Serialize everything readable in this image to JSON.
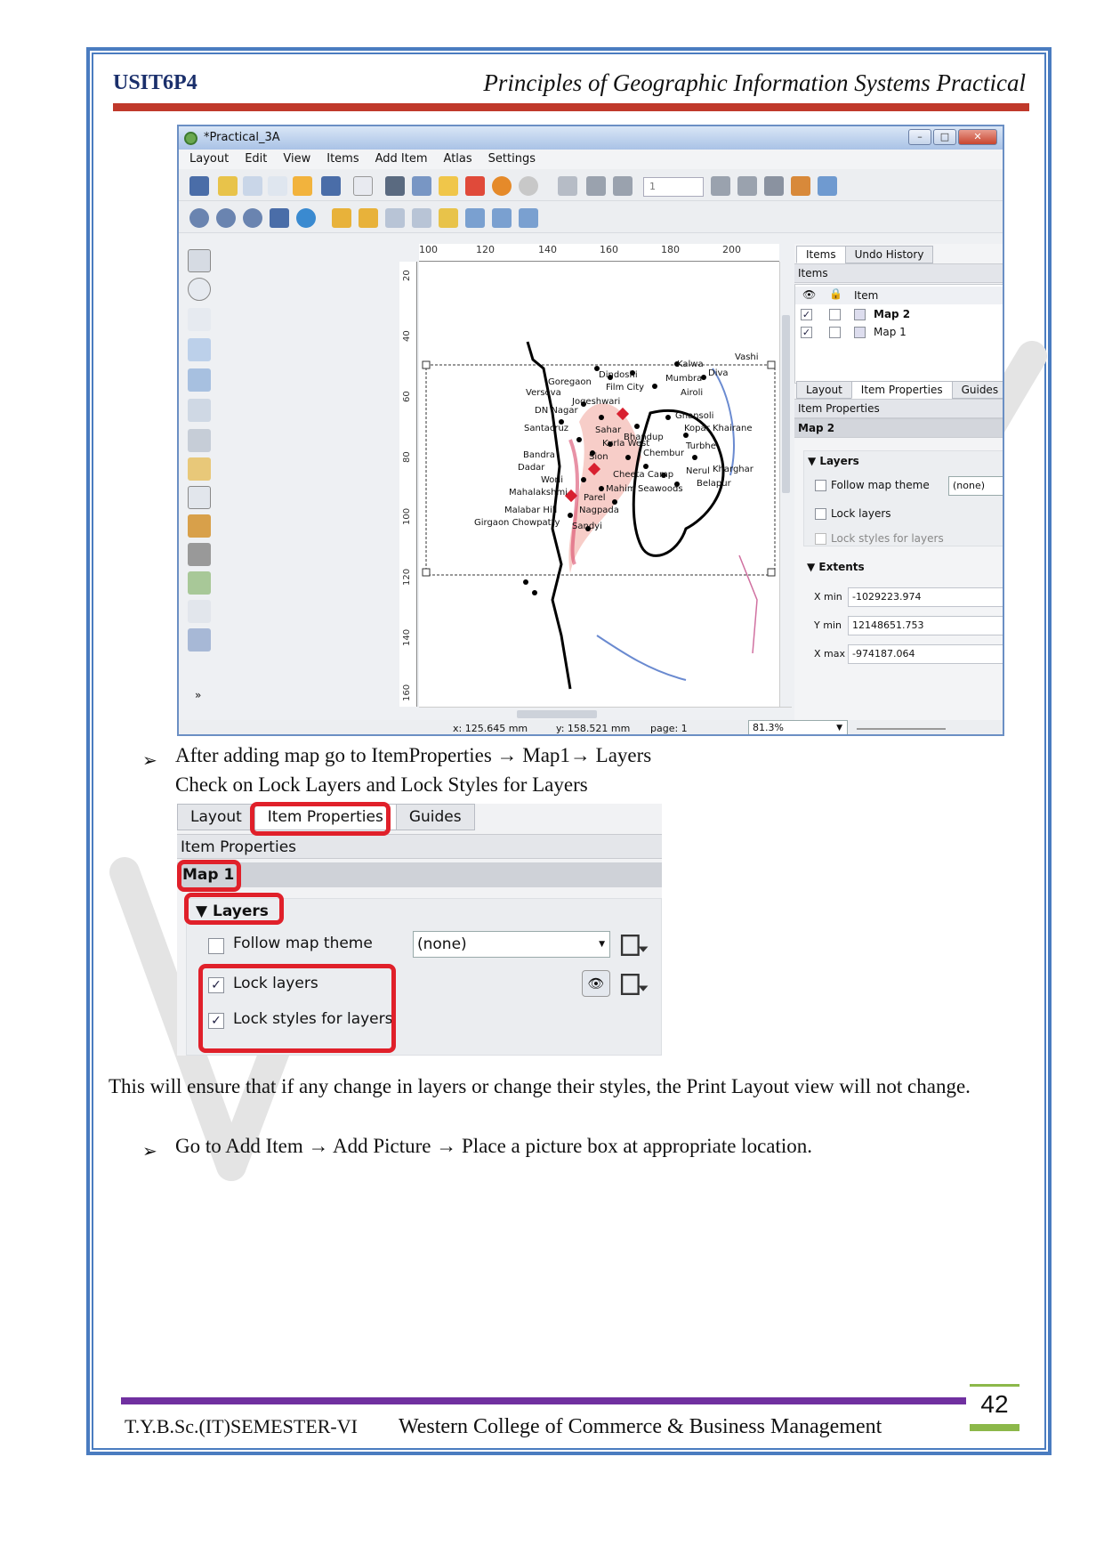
{
  "header": {
    "code": "USIT6P4",
    "title": "Principles of Geographic Information Systems Practical"
  },
  "qgis": {
    "window_title": "*Practical_3A",
    "menu": [
      "Layout",
      "Edit",
      "View",
      "Items",
      "Add Item",
      "Atlas",
      "Settings"
    ],
    "page_field": "1",
    "ruler_h": [
      "100",
      "120",
      "140",
      "160",
      "180",
      "200"
    ],
    "ruler_v": [
      "20",
      "40",
      "60",
      "80",
      "100",
      "120",
      "140",
      "160"
    ],
    "top_tabs": [
      "Items",
      "Undo History"
    ],
    "items_panel_title": "Items",
    "items_header": "Item",
    "items": [
      "Map 2",
      "Map 1"
    ],
    "bottom_tabs": [
      "Layout",
      "Item Properties",
      "Guides"
    ],
    "item_props_title": "Item Properties",
    "selected_item": "Map 2",
    "layers_group": "Layers",
    "follow_map_theme": "Follow map theme",
    "theme_value": "(none)",
    "lock_layers": "Lock layers",
    "lock_styles": "Lock styles for layers",
    "extents_group": "Extents",
    "extents": [
      {
        "label": "X min",
        "value": "-1029223.974"
      },
      {
        "label": "Y min",
        "value": "12148651.753"
      },
      {
        "label": "X max",
        "value": "-974187.064"
      }
    ],
    "status": {
      "x": "x: 125.645 mm",
      "y": "y: 158.521 mm",
      "page": "page: 1",
      "zoom": "81.3%"
    },
    "map_labels": [
      "Kalwa",
      "Diva",
      "Mumbra",
      "Airoli",
      "Ghansoli",
      "Kopar Khairane",
      "Turbhe",
      "Nerul",
      "Kharghar",
      "Belapur",
      "Vashi",
      "Dindoshi",
      "Film City",
      "Goregaon",
      "Jogeshwari",
      "Versova",
      "DN Nagar",
      "Santacruz",
      "Sahar",
      "Kurla West",
      "Bandra",
      "Dadar",
      "Worli",
      "Sion",
      "Chembur",
      "Cheeta Camp",
      "Seawoods",
      "Mahim",
      "Mahalakshmi",
      "Malabar Hill",
      "Parel",
      "Girgaon Chowpatty",
      "Bhandup",
      "Nagpada",
      "Sandyi"
    ]
  },
  "instructions": {
    "step1_line1": "After adding map go to ItemProperties → Map1→ Layers",
    "step1_line2": "Check on Lock Layers and Lock Styles for Layers",
    "para1": "This will ensure that if any change in layers or change their styles, the Print Layout view will not change.",
    "step2": "Go to Add Item → Add Picture → Place a picture box at appropriate location."
  },
  "zoom_panel": {
    "tabs": [
      "Layout",
      "Item Properties",
      "Guides"
    ],
    "title": "Item Properties",
    "selected_item": "Map 1",
    "layers_group": "Layers",
    "follow_map_theme": "Follow map theme",
    "theme_value": "(none)",
    "lock_layers": "Lock layers",
    "lock_styles": "Lock styles for layers"
  },
  "footer": {
    "left": "T.Y.B.Sc.(IT)SEMESTER-VI",
    "center": "Western College of Commerce & Business Management",
    "page_number": "42"
  },
  "colors": {
    "border": "#4a7cc0",
    "header_rule": "#c0392b",
    "footer_rule": "#7030a0",
    "page_accent": "#8cb84a",
    "highlight": "#e0202a"
  }
}
